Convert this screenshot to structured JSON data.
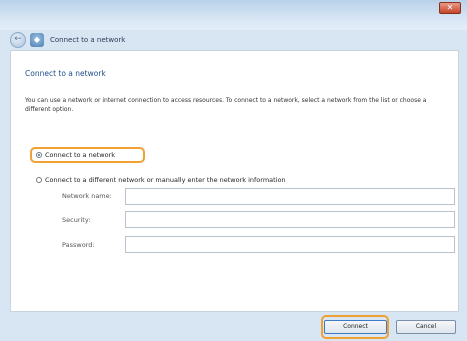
{
  "window": {
    "title": "Connect to a network",
    "close_label": "✕"
  },
  "page": {
    "heading": "Connect to a network",
    "description": "You can use a network or internet connection to access resources. To connect to a network, select a network from the list or choose a different option."
  },
  "options": {
    "option1": "Connect to a network",
    "option2": "Connect to a different network or manually enter the network information"
  },
  "fields": [
    {
      "label": "Network name:",
      "value": ""
    },
    {
      "label": "Security:",
      "value": ""
    },
    {
      "label": "Password:",
      "value": ""
    }
  ],
  "buttons": {
    "connect": "Connect",
    "cancel": "Cancel"
  }
}
